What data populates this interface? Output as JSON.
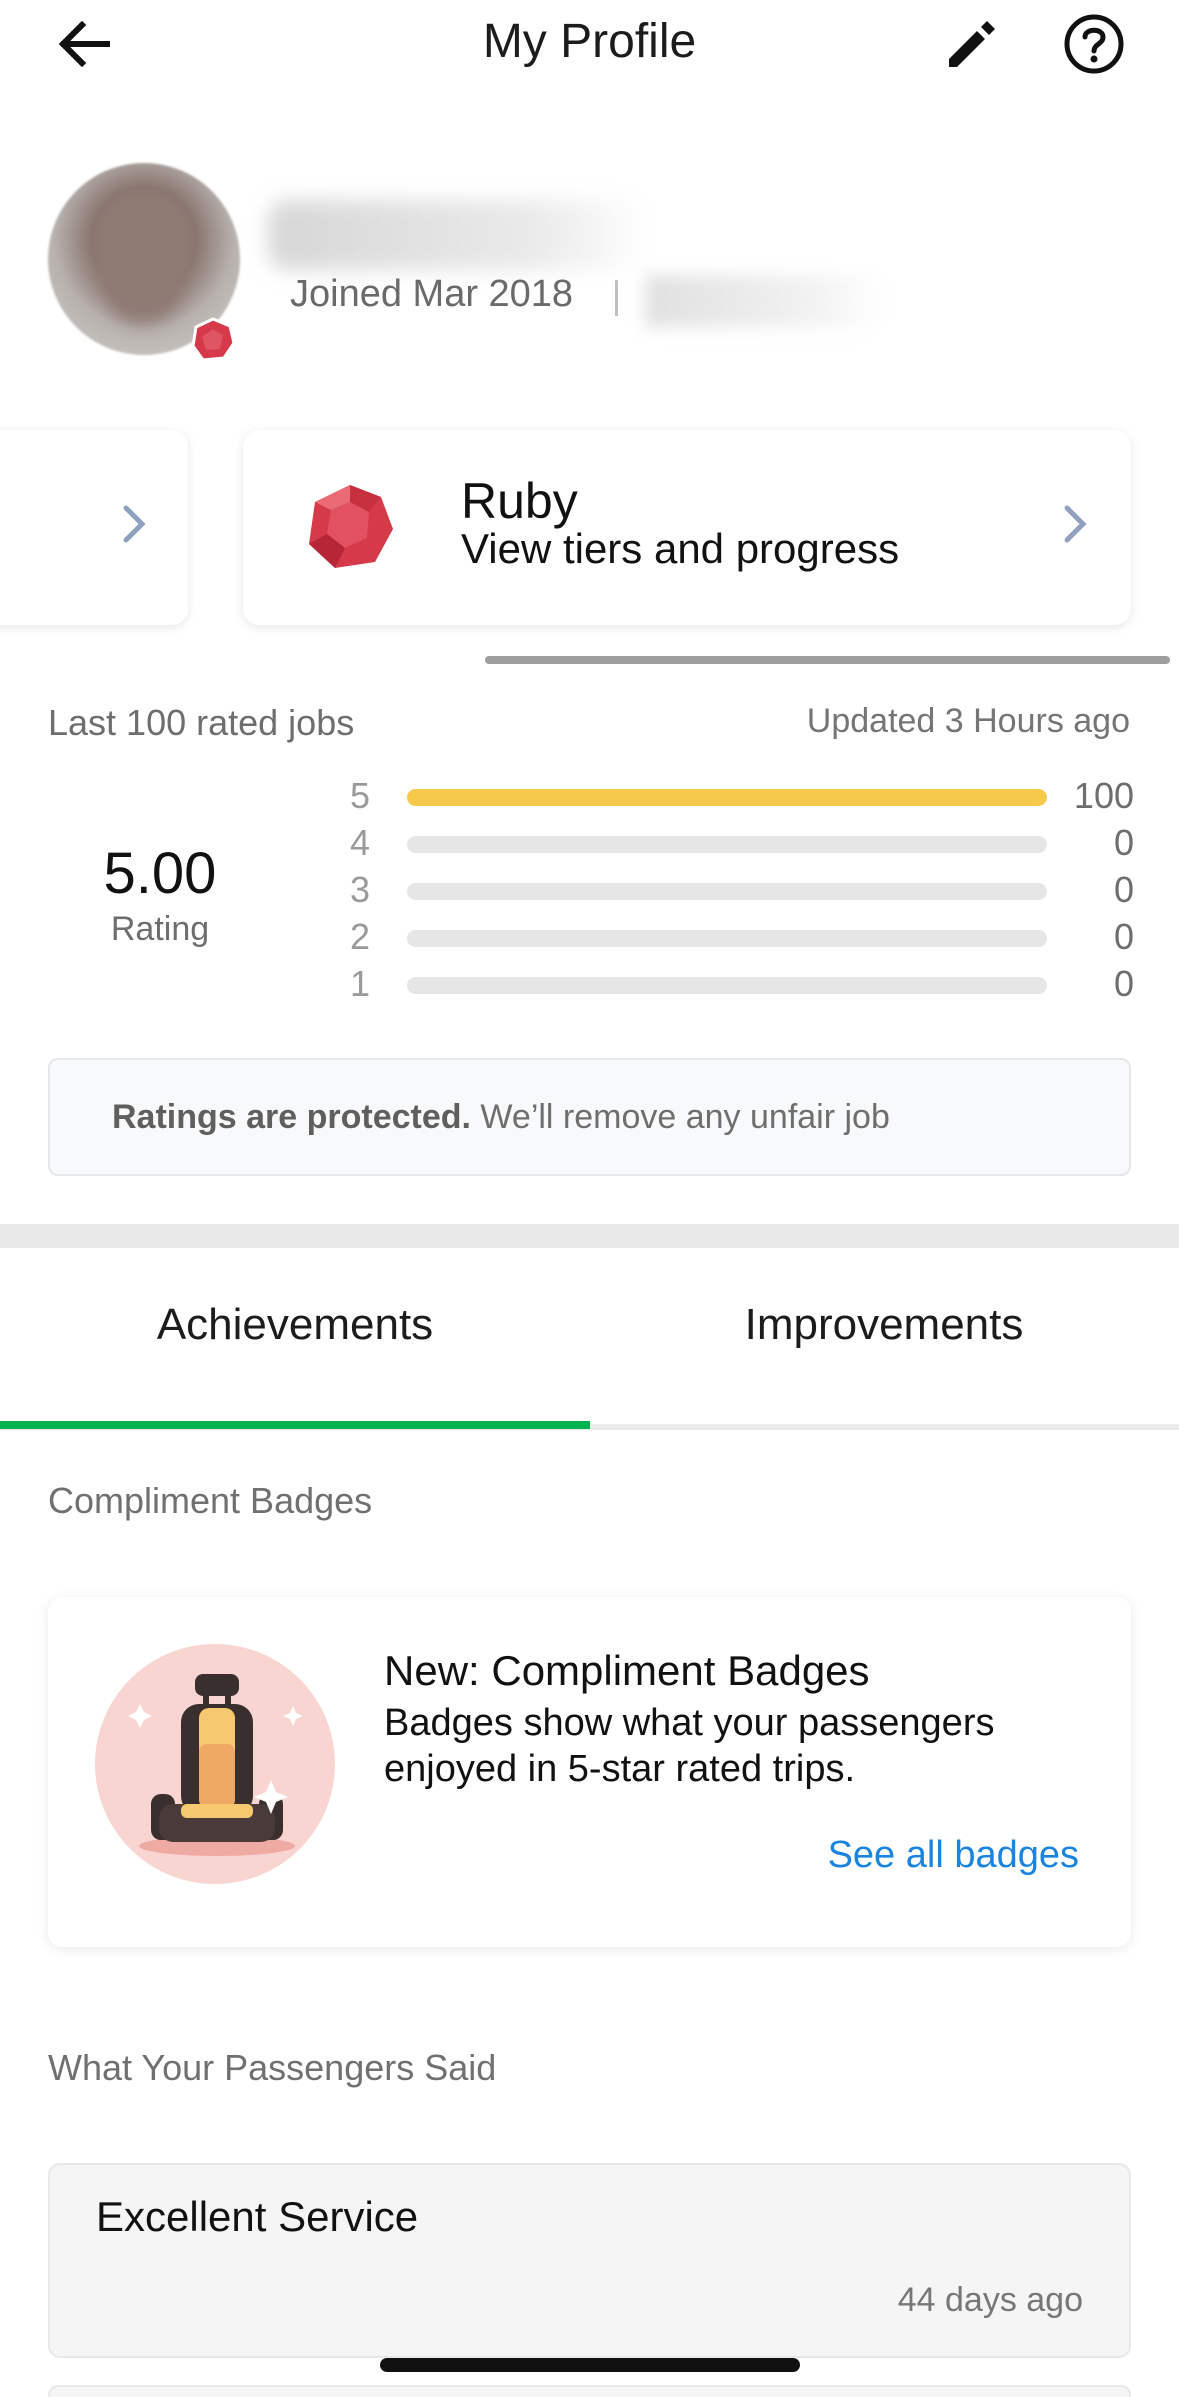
{
  "header": {
    "title": "My Profile",
    "back_icon": "arrow-left-icon",
    "edit_icon": "pencil-icon",
    "help_icon": "question-circle-icon"
  },
  "profile": {
    "joined": "Joined Mar 2018"
  },
  "tier_card": {
    "name": "Ruby",
    "subtitle": "View tiers and progress",
    "gem_color": "#d63a4a"
  },
  "ratings": {
    "header_label": "Last 100 rated jobs",
    "updated": "Updated 3 Hours ago",
    "average": "5.00",
    "average_label": "Rating",
    "bar_color": "#f6c94a",
    "rows": [
      {
        "star": "5",
        "count": "100",
        "fraction": 1.0
      },
      {
        "star": "4",
        "count": "0",
        "fraction": 0
      },
      {
        "star": "3",
        "count": "0",
        "fraction": 0
      },
      {
        "star": "2",
        "count": "0",
        "fraction": 0
      },
      {
        "star": "1",
        "count": "0",
        "fraction": 0
      }
    ],
    "notice_bold": "Ratings are protected.",
    "notice_rest": " We’ll remove any unfair job"
  },
  "tabs": [
    {
      "label": "Achievements",
      "active": true
    },
    {
      "label": "Improvements",
      "active": false
    }
  ],
  "accent_color": "#00b14f",
  "compliment_section": {
    "title": "Compliment Badges",
    "card_title": "New: Compliment Badges",
    "card_desc": "Badges show what your passengers enjoyed in 5-star rated trips.",
    "link": "See all badges"
  },
  "passenger_section": {
    "title": "What Your Passengers Said",
    "comments": [
      {
        "text": "Excellent Service",
        "time": "44 days ago"
      }
    ]
  }
}
